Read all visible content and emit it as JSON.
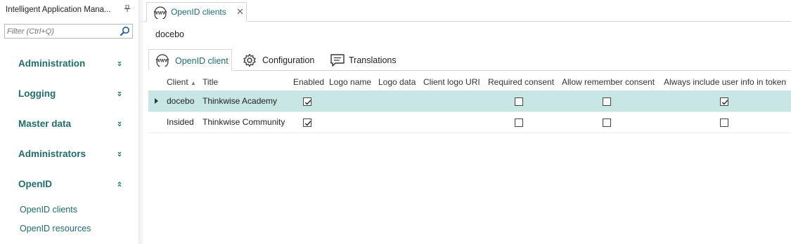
{
  "sidebar": {
    "title": "Intelligent Application Mana...",
    "filter_placeholder": "Filter (Ctrl+Q)",
    "groups": [
      {
        "label": "Administration",
        "expanded": false
      },
      {
        "label": "Logging",
        "expanded": false
      },
      {
        "label": "Master data",
        "expanded": false
      },
      {
        "label": "Administrators",
        "expanded": false
      },
      {
        "label": "OpenID",
        "expanded": true
      }
    ],
    "openid_items": [
      {
        "label": "OpenID clients"
      },
      {
        "label": "OpenID resources"
      }
    ]
  },
  "document_tab": {
    "label": "OpenID clients"
  },
  "record": {
    "title": "docebo"
  },
  "subtabs": [
    {
      "label": "OpenID client",
      "icon": "www-icon",
      "active": true
    },
    {
      "label": "Configuration",
      "icon": "gear-icon",
      "active": false
    },
    {
      "label": "Translations",
      "icon": "chat-icon",
      "active": false
    }
  ],
  "grid": {
    "columns": [
      "Client",
      "Title",
      "Enabled",
      "Logo name",
      "Logo data",
      "Client logo URI",
      "Required consent",
      "Allow remember consent",
      "Always include user info in token"
    ],
    "rows": [
      {
        "client": "docebo",
        "title": "Thinkwise Academy",
        "enabled": true,
        "logo_name": "",
        "logo_data": "",
        "client_logo_uri": "",
        "required_consent": false,
        "allow_remember_consent": false,
        "always_include_user_info": true,
        "selected": true
      },
      {
        "client": "Insided",
        "title": "Thinkwise Community",
        "enabled": true,
        "logo_name": "",
        "logo_data": "",
        "client_logo_uri": "",
        "required_consent": false,
        "allow_remember_consent": false,
        "always_include_user_info": false,
        "selected": false
      }
    ]
  },
  "colors": {
    "accent": "#1e6e6e",
    "selection": "#c8e6e3"
  }
}
